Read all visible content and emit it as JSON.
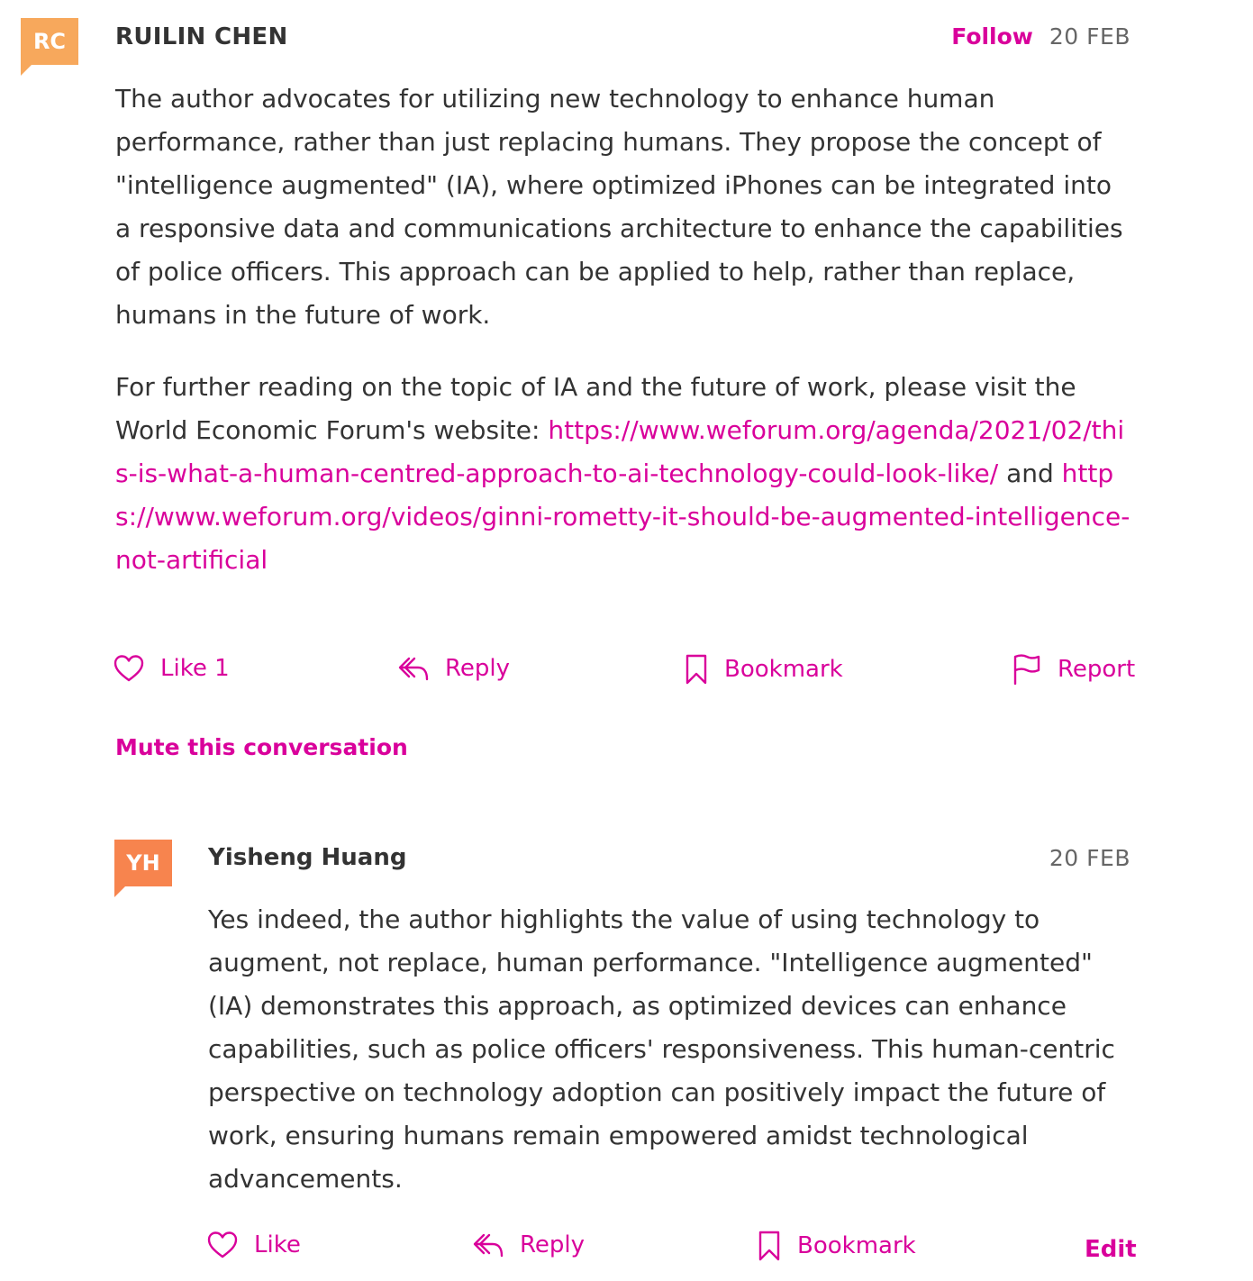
{
  "comments": [
    {
      "initials": "RC",
      "avatar_color": "#f7a85c",
      "author": "RUILIN CHEN",
      "follow_label": "Follow",
      "date": "20 FEB",
      "paragraph1": "The author advocates for utilizing new technology to enhance human performance, rather than just replacing humans. They propose the concept of \"intelligence augmented\" (IA), where optimized iPhones can be integrated into a responsive data and communications architecture to enhance the capabilities of police officers. This approach can be applied to help, rather than replace, humans in the future of work.",
      "paragraph2_text": "For further reading on the topic of IA and the future of work, please visit the World Economic Forum's website:",
      "link1": "https://www.weforum.org/agenda/2021/02/this-is-what-a-human-centred-approach-to-ai-technology-could-look-like/",
      "link_joiner": "and",
      "link2": "https://www.weforum.org/videos/ginni-rometty-it-should-be-augmented-intelligence-not-artificial",
      "like_label": "Like 1",
      "reply_label": "Reply",
      "bookmark_label": "Bookmark",
      "report_label": "Report",
      "mute_label": "Mute this conversation"
    },
    {
      "initials": "YH",
      "avatar_color": "#f7844e",
      "author": "Yisheng Huang",
      "date": "20 FEB",
      "paragraph1": "Yes indeed, the author highlights the value of using technology to augment, not replace, human performance. \"Intelligence augmented\" (IA) demonstrates this approach, as optimized devices can enhance capabilities, such as police officers' responsiveness. This human-centric perspective on technology adoption can positively impact the future of work, ensuring humans remain empowered amidst technological advancements.",
      "like_label": "Like",
      "reply_label": "Reply",
      "bookmark_label": "Bookmark",
      "edit_label": "Edit"
    }
  ],
  "icons": {
    "like": "heart-icon",
    "reply": "reply-arrow-icon",
    "bookmark": "bookmark-icon",
    "report": "flag-icon"
  },
  "colors": {
    "accent": "#d9009b",
    "text": "#333333",
    "muted": "#666666"
  }
}
